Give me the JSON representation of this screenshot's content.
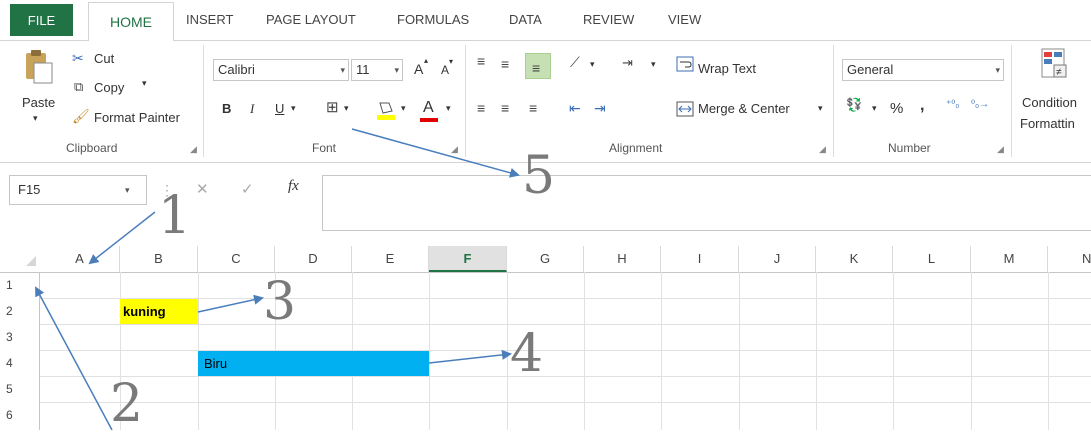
{
  "tabs": [
    "FILE",
    "HOME",
    "INSERT",
    "PAGE LAYOUT",
    "FORMULAS",
    "DATA",
    "REVIEW",
    "VIEW"
  ],
  "clipboard": {
    "paste": "Paste",
    "cut": "Cut",
    "copy": "Copy",
    "format_painter": "Format Painter",
    "label": "Clipboard"
  },
  "font": {
    "name": "Calibri",
    "size": "11",
    "grow": "A",
    "shrink": "A",
    "bold": "B",
    "italic": "I",
    "underline": "U",
    "color_a": "A",
    "label": "Font"
  },
  "alignment": {
    "wrap": "Wrap Text",
    "merge": "Merge & Center",
    "label": "Alignment"
  },
  "number": {
    "format": "General",
    "percent": "%",
    "comma": ",",
    "label": "Number"
  },
  "styles": {
    "conditional_1": "Condition",
    "conditional_2": "Formattin"
  },
  "formula_bar": {
    "name_box": "F15",
    "fx": "fx",
    "value": ""
  },
  "columns": [
    "A",
    "B",
    "C",
    "D",
    "E",
    "F",
    "G",
    "H",
    "I",
    "J",
    "K",
    "L",
    "M",
    "N"
  ],
  "rows": [
    "1",
    "2",
    "3",
    "4",
    "5",
    "6"
  ],
  "cells": {
    "b2": "kuning",
    "c4": "Biru"
  },
  "annotations": [
    "1",
    "2",
    "3",
    "4",
    "5"
  ],
  "colors": {
    "accent": "#217346",
    "yellow": "#ffff00",
    "blue": "#00b0f0",
    "arrow": "#4a7ebb",
    "active_col": "#e1e1e1"
  }
}
